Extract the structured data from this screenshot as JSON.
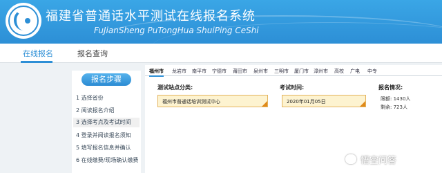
{
  "header": {
    "title": "福建省普通话水平测试在线报名系统",
    "subtitle": "FuJianSheng  PuTongHua ShuiPing CeShi"
  },
  "tabs": [
    {
      "label": "在线报名",
      "active": true
    },
    {
      "label": "报名查询",
      "active": false
    }
  ],
  "steps": {
    "header": "报名步骤",
    "items": [
      "1 选择省份",
      "2 阅读报名介绍",
      "3 选择考点及考试时间",
      "4 登录并阅读报名须知",
      "5 填写报名信息并确认",
      "6 在线缴费/现场确认缴费"
    ],
    "active_index": 2
  },
  "cities": [
    "福州市",
    "龙岩市",
    "南平市",
    "宁德市",
    "莆田市",
    "泉州市",
    "三明市",
    "厦门市",
    "漳州市",
    "高校",
    "广电",
    "中专"
  ],
  "active_city": "福州市",
  "form": {
    "site_label": "测试站点分类:",
    "site_value": "福州市普通话培训测试中心",
    "time_label": "考试时间:",
    "time_value": "2020年01月05日",
    "status_label": "报名情况:",
    "quota": "限额: 1430人",
    "remaining": "剩余: 723人"
  },
  "watermark": "悟空问答",
  "colors": {
    "accent": "#2d8fd6",
    "field_bg": "#fdf3d0",
    "field_corner": "#e08a1a"
  }
}
